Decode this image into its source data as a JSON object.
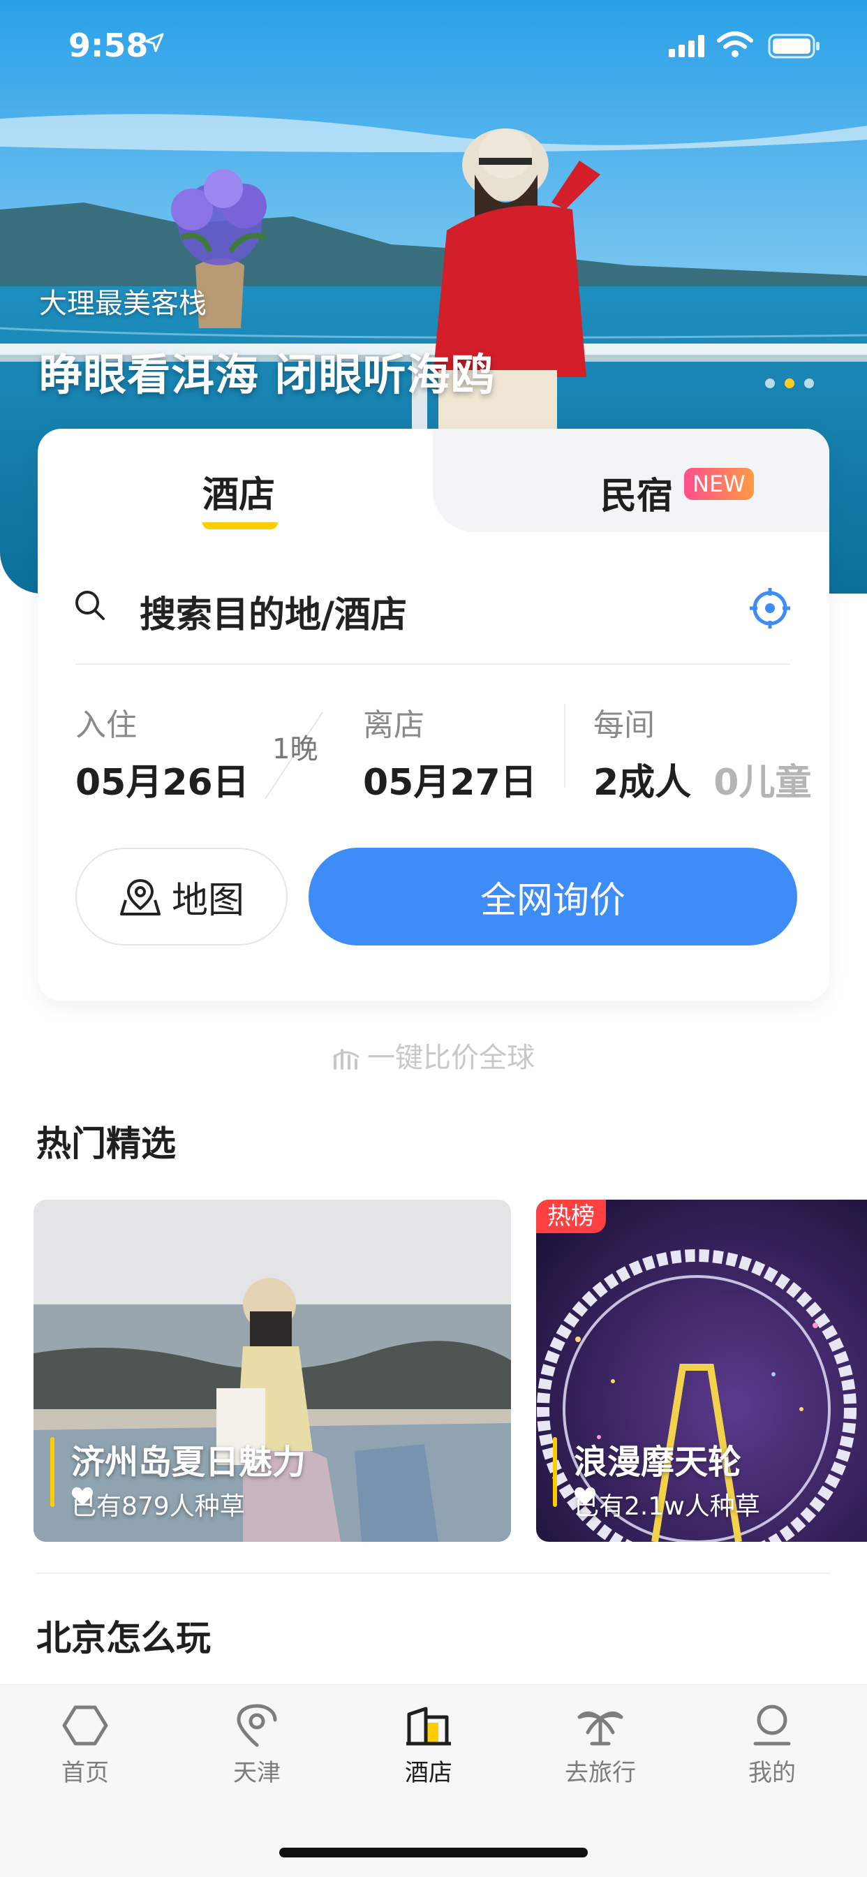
{
  "status_bar": {
    "time": "9:58"
  },
  "banner": {
    "subtitle": "大理最美客栈",
    "title": "睁眼看洱海 闭眼听海鸥",
    "dots_total": 3,
    "dot_active_index": 1
  },
  "search_card": {
    "tabs": {
      "hotel": "酒店",
      "homestay": "民宿",
      "homestay_badge": "NEW"
    },
    "search_placeholder": "搜索目的地/酒店",
    "checkin": {
      "label": "入住",
      "date": "05月26日"
    },
    "nights": "1晚",
    "checkout": {
      "label": "离店",
      "date": "05月27日"
    },
    "guests": {
      "label": "每间",
      "adults": "2成人",
      "children": "0儿童"
    },
    "map_button": "地图",
    "query_button": "全网询价"
  },
  "compare_tagline": "一键比价全球",
  "hot_picks": {
    "title": "热门精选",
    "items": [
      {
        "title": "济州岛夏日魅力",
        "count": "已有879人种草",
        "badge": ""
      },
      {
        "title": "浪漫摩天轮",
        "count": "已有2.1w人种草",
        "badge": "热榜"
      }
    ]
  },
  "city_section": {
    "title": "北京怎么玩"
  },
  "tab_bar": {
    "items": [
      {
        "label": "首页",
        "icon": "home-icon"
      },
      {
        "label": "天津",
        "icon": "city-location-icon"
      },
      {
        "label": "酒店",
        "icon": "hotel-icon",
        "active": true
      },
      {
        "label": "去旅行",
        "icon": "palm-tree-icon"
      },
      {
        "label": "我的",
        "icon": "profile-icon"
      }
    ]
  },
  "colors": {
    "accent_blue": "#3d8cf7",
    "accent_yellow": "#ffcc00",
    "hot_red": "#ff4040",
    "new_badge_gradient": [
      "#ff4f8b",
      "#ff9a45"
    ]
  }
}
